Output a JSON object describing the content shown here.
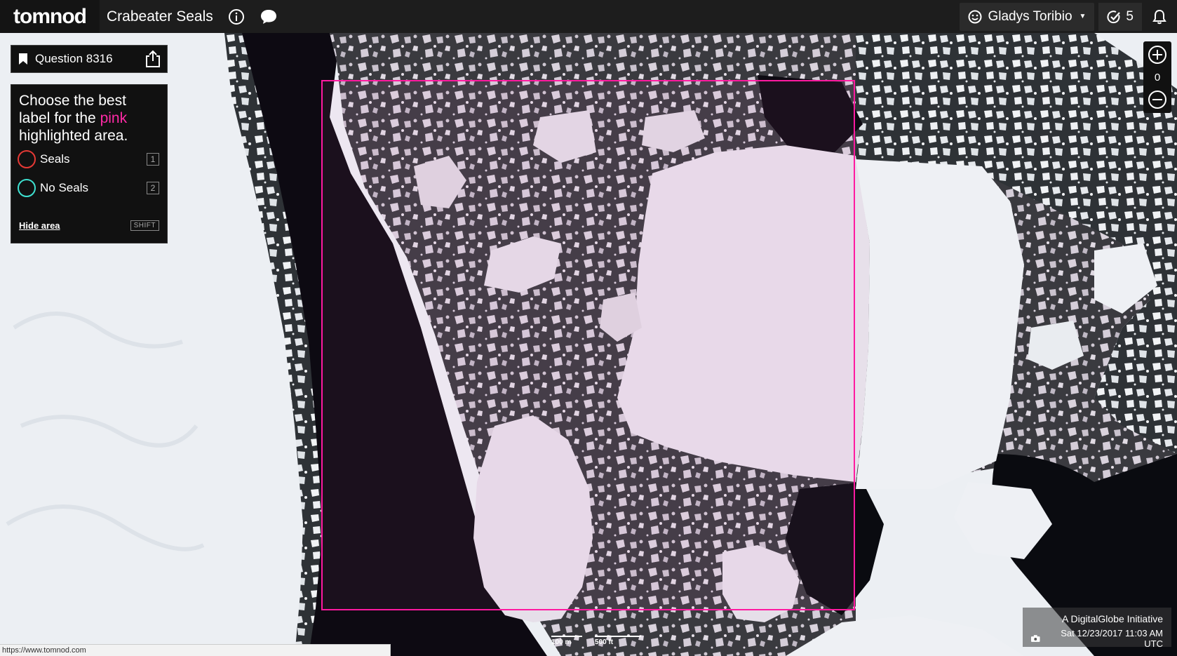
{
  "header": {
    "logo_text": "tomnod",
    "project_title": "Crabeater Seals",
    "user_name": "Gladys Toribio",
    "tasks_done": "5",
    "icons": {
      "info": "info-circle-icon",
      "chat": "chat-bubble-icon",
      "user": "smiley-face-icon",
      "tasks": "check-circle-icon",
      "bell": "bell-icon"
    }
  },
  "question": {
    "title": "Question 8316",
    "prompt_before": "Choose the best label for the ",
    "prompt_highlight": "pink",
    "prompt_after": " highlighted area.",
    "options": [
      {
        "label": "Seals",
        "key": "1",
        "color": "#e53935"
      },
      {
        "label": "No Seals",
        "key": "2",
        "color": "#3ee0d0"
      }
    ],
    "hide_area_label": "Hide area",
    "hide_area_key": "SHIFT"
  },
  "map": {
    "zoom_level": "0",
    "highlight_color": "#ff1aa0",
    "attribution_line1": "A DigitalGlobe Initiative",
    "attribution_line2": "Sat 12/23/2017 11:03 AM UTC",
    "scale_metric": "100 m",
    "scale_imperial": "500 ft"
  },
  "status_bar": {
    "url": "https://www.tomnod.com"
  },
  "colors": {
    "topbar": "#1d1d1d",
    "panel": "#111111",
    "accent_pink": "#ff2aa6"
  }
}
